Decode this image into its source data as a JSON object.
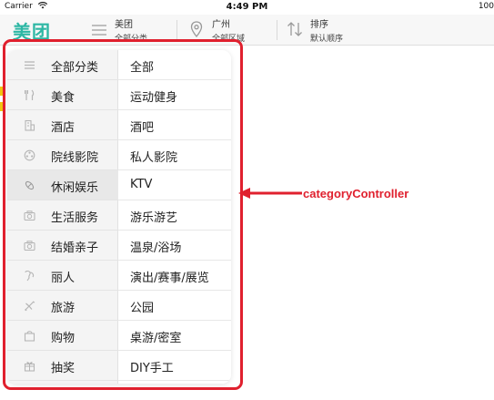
{
  "status_bar": {
    "carrier": "Carrier",
    "time": "4:49 PM",
    "battery": "100"
  },
  "nav": {
    "logo": "美团",
    "category": {
      "title": "美团",
      "subtitle": "全部分类",
      "icon": "list-icon"
    },
    "area": {
      "title": "广州",
      "subtitle": "全部区域",
      "icon": "location-pin-icon"
    },
    "sort": {
      "title": "排序",
      "subtitle": "默认顺序",
      "icon": "sort-arrows-icon"
    }
  },
  "categories": [
    {
      "label": "全部分类",
      "icon": "list-icon",
      "selected": false
    },
    {
      "label": "美食",
      "icon": "fork-knife-icon",
      "selected": false
    },
    {
      "label": "酒店",
      "icon": "building-icon",
      "selected": false
    },
    {
      "label": "院线影院",
      "icon": "film-reel-icon",
      "selected": false
    },
    {
      "label": "休闲娱乐",
      "icon": "leisure-icon",
      "selected": true
    },
    {
      "label": "生活服务",
      "icon": "camera-icon",
      "selected": false
    },
    {
      "label": "结婚亲子",
      "icon": "camera-icon",
      "selected": false
    },
    {
      "label": "丽人",
      "icon": "beauty-icon",
      "selected": false
    },
    {
      "label": "旅游",
      "icon": "airplane-icon",
      "selected": false
    },
    {
      "label": "购物",
      "icon": "shopping-bag-icon",
      "selected": false
    },
    {
      "label": "抽奖",
      "icon": "gift-icon",
      "selected": false
    }
  ],
  "subcategories": [
    "全部",
    "运动健身",
    "酒吧",
    "私人影院",
    "KTV",
    "游乐游艺",
    "温泉/浴场",
    "演出/赛事/展览",
    "公园",
    "桌游/密室",
    "DIY手工"
  ],
  "annotation": {
    "label": "categoryController",
    "color": "#e0202e"
  },
  "colors": {
    "brand": "#2db7a4",
    "annotation_red": "#e0202e"
  }
}
